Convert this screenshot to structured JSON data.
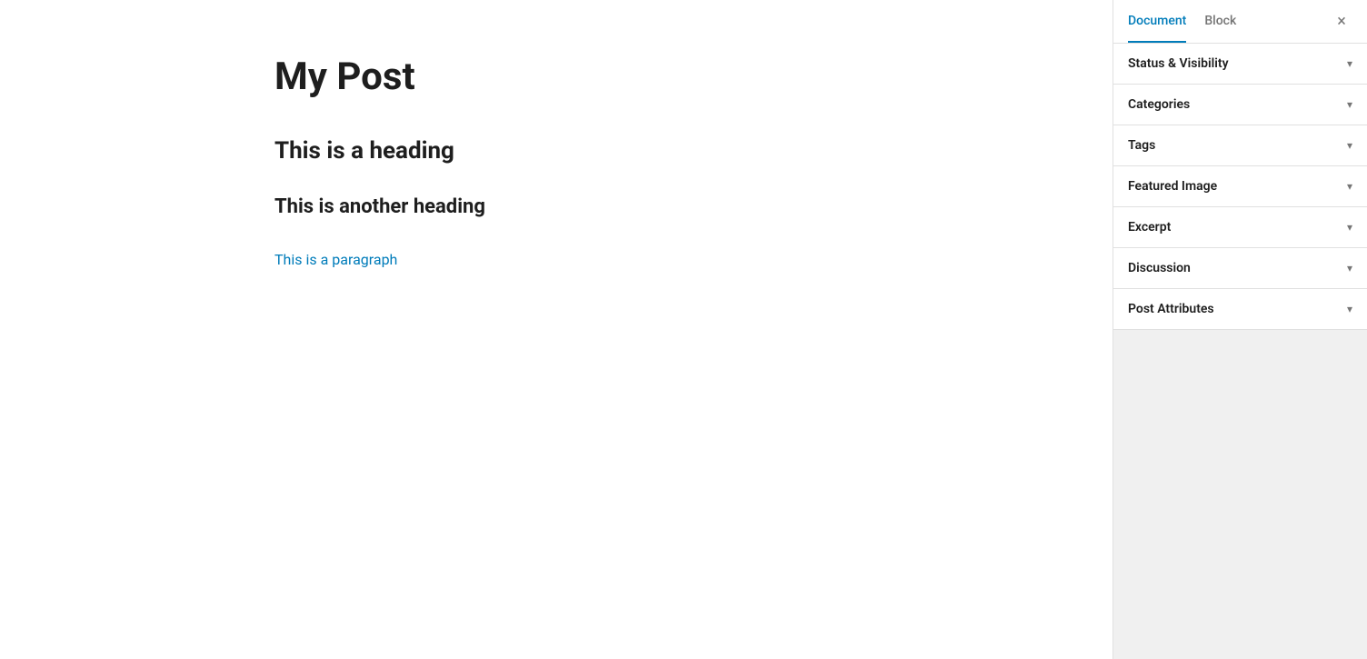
{
  "editor": {
    "post_title": "My Post",
    "heading1": "This is a heading",
    "heading2": "This is another heading",
    "paragraph": "This is a paragraph"
  },
  "sidebar": {
    "tabs": [
      {
        "id": "document",
        "label": "Document",
        "active": true
      },
      {
        "id": "block",
        "label": "Block",
        "active": false
      }
    ],
    "close_label": "×",
    "panels": [
      {
        "id": "status-visibility",
        "label": "Status & Visibility"
      },
      {
        "id": "categories",
        "label": "Categories"
      },
      {
        "id": "tags",
        "label": "Tags"
      },
      {
        "id": "featured-image",
        "label": "Featured Image"
      },
      {
        "id": "excerpt",
        "label": "Excerpt"
      },
      {
        "id": "discussion",
        "label": "Discussion"
      },
      {
        "id": "post-attributes",
        "label": "Post Attributes"
      }
    ]
  }
}
